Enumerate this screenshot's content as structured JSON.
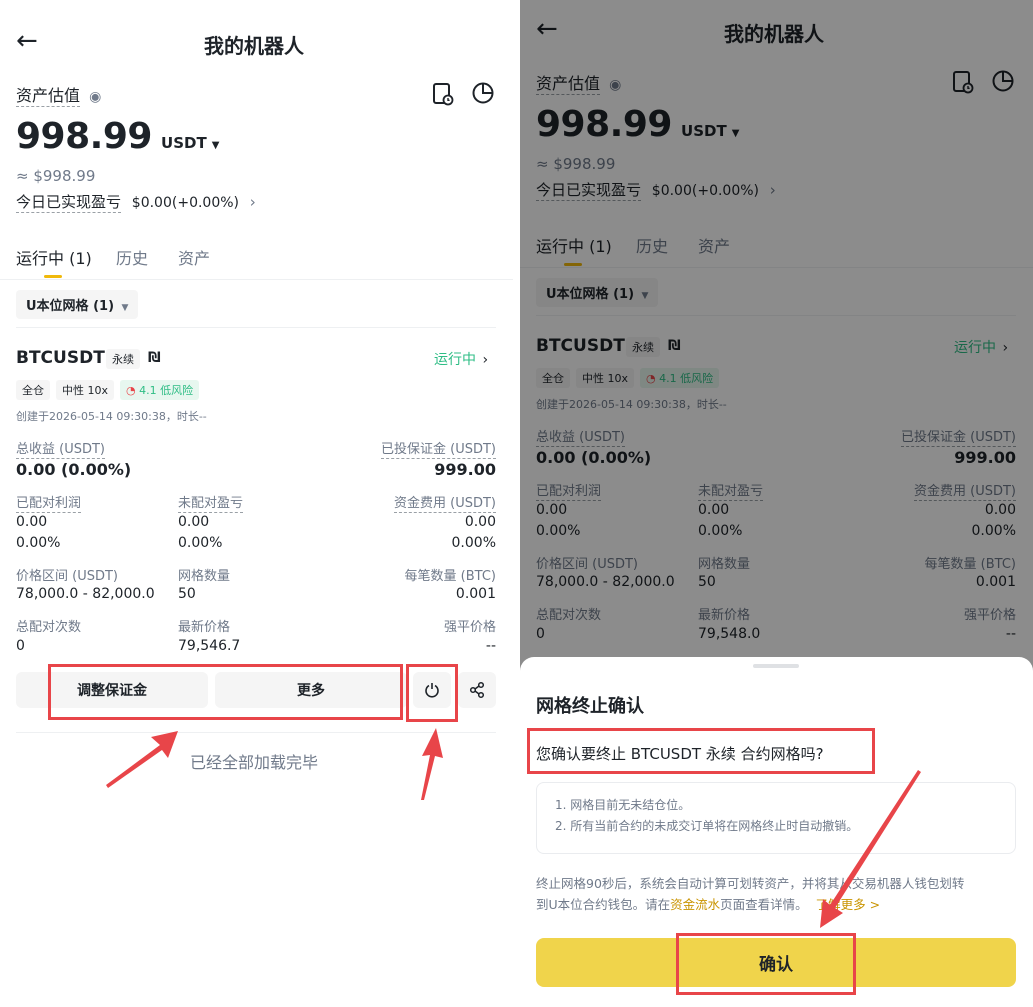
{
  "header": {
    "title": "我的机器人"
  },
  "asset": {
    "label": "资产估值",
    "amount": "998.99",
    "unit": "USDT",
    "usd": "≈ $998.99",
    "pnl_label": "今日已实现盈亏",
    "pnl_value": "$0.00(+0.00%)"
  },
  "tabs": {
    "running": "运行中 (1)",
    "history": "历史",
    "assets": "资产"
  },
  "filter": {
    "label": "U本位网格 (1)"
  },
  "bot": {
    "symbol": "BTCUSDT",
    "type_tag": "永续",
    "status": "运行中",
    "tags": {
      "margin": "全仓",
      "mode": "中性 10x",
      "risk": "4.1 低风险"
    },
    "created": "创建于2026-05-14 09:30:38，时长--",
    "total_profit_label": "总收益 (USDT)",
    "total_profit": "0.00 (0.00%)",
    "invested_label": "已投保证金 (USDT)",
    "invested": "999.00",
    "matched_profit_label": "已配对利润",
    "matched_profit": "0.00",
    "matched_profit_pct": "0.00%",
    "unmatched_label": "未配对盈亏",
    "unmatched": "0.00",
    "unmatched_pct": "0.00%",
    "funding_label": "资金费用 (USDT)",
    "funding": "0.00",
    "funding_pct": "0.00%",
    "range_label": "价格区间 (USDT)",
    "range": "78,000.0 - 82,000.0",
    "grid_count_label": "网格数量",
    "grid_count": "50",
    "per_order_label": "每笔数量 (BTC)",
    "per_order": "0.001",
    "match_count_label": "总配对次数",
    "match_count": "0",
    "last_price_label": "最新价格",
    "last_price_left": "79,546.7",
    "last_price_right": "79,548.0",
    "liq_label": "强平价格",
    "liq": "--"
  },
  "actions": {
    "adjust": "调整保证金",
    "more": "更多"
  },
  "footer": {
    "loaded": "已经全部加载完毕"
  },
  "dialog": {
    "title": "网格终止确认",
    "question": "您确认要终止 BTCUSDT 永续 合约网格吗?",
    "notice_1": "1. 网格目前无未结仓位。",
    "notice_2": "2. 所有当前合约的未成交订单将在网格终止时自动撤销。",
    "info_a": "终止网格90秒后，系统会自动计算可划转资产，并将其从交易机器人钱包划转",
    "info_b": "到U本位合约钱包。请在",
    "info_link": "资金流水",
    "info_c": "页面查看详情。",
    "learn_more": "了解更多 >",
    "confirm": "确认"
  },
  "colors": {
    "accent": "#f0b90b",
    "green": "#2ebd85",
    "highlight": "#e84549",
    "confirm_bg": "#f0d44b"
  }
}
